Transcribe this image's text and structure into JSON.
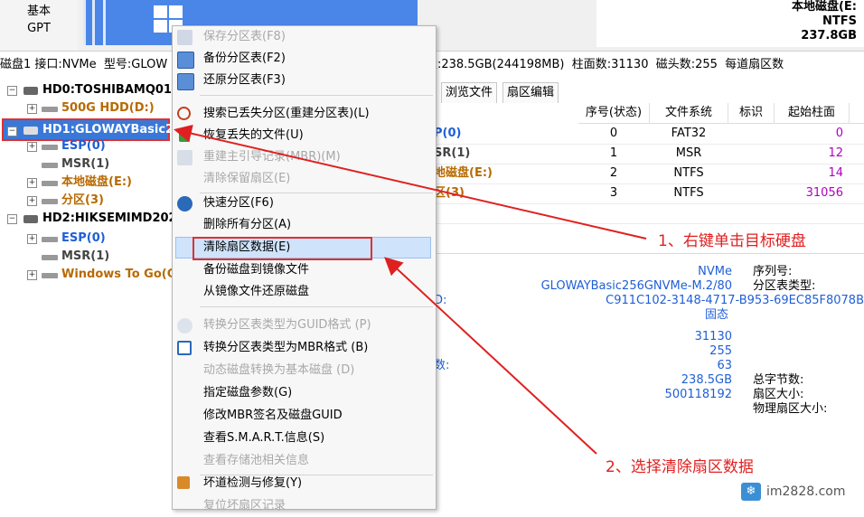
{
  "disk_strip": {
    "basic_label": "基本",
    "gpt_label": "GPT",
    "volume_name": "本地磁盘(E:",
    "volume_fs": "NTFS",
    "volume_size": "237.8GB"
  },
  "info_line": "磁盘1 接口:NVMe  型号:GLOW                                                    240057  容量:238.5GB(244198MB)  柱面数:31130  磁头数:255  每道扇区数",
  "tree": {
    "hd0": "HD0:TOSHIBAMQ01A",
    "hd0_vol": "500G HDD(D:)",
    "hd1": "HD1:GLOWAYBasic2",
    "hd1_vols": [
      "ESP(0)",
      "MSR(1)",
      "本地磁盘(E:)",
      "分区(3)"
    ],
    "hd2": "HD2:HIKSEMIMD202",
    "hd2_vols": [
      "ESP(0)",
      "MSR(1)",
      "Windows To Go(C"
    ]
  },
  "tabs": [
    "浏览文件",
    "扇区编辑"
  ],
  "grid": {
    "headers": [
      "序号(状态)",
      "文件系统",
      "标识",
      "起始柱面"
    ],
    "rows": [
      {
        "name": "P(0)",
        "idx": "0",
        "fs": "FAT32",
        "start": "0"
      },
      {
        "name": "SR(1)",
        "idx": "1",
        "fs": "MSR",
        "start": "12"
      },
      {
        "name": "地磁盘(E:)",
        "idx": "2",
        "fs": "NTFS",
        "start": "14"
      },
      {
        "name": "区(3)",
        "idx": "3",
        "fs": "NTFS",
        "start": "31056"
      }
    ]
  },
  "detail": {
    "interface": "NVMe",
    "model": "GLOWAYBasic256GNVMe-M.2/80",
    "guid": "C911C102-3148-4717-B953-69EC85F8078B",
    "media": "固态",
    "cylinders": "31130",
    "heads": "255",
    "sectors": "63",
    "capacity": "238.5GB",
    "total_sectors": "500118192",
    "label_serial": "序列号:",
    "label_ptype": "分区表类型:",
    "label_total_bytes": "总字节数:",
    "label_sector_size": "扇区大小:",
    "label_phys_sector": "物理扇区大小:",
    "frag_d": "D:",
    "frag_shu": "数:"
  },
  "menu": {
    "items": [
      {
        "label": "保存分区表(F8)",
        "enabled": false,
        "icon": "save-icon"
      },
      {
        "label": "备份分区表(F2)",
        "enabled": true,
        "icon": "backup-table-icon"
      },
      {
        "label": "还原分区表(F3)",
        "enabled": true,
        "icon": "restore-table-icon"
      },
      {
        "label": "搜索已丢失分区(重建分区表)(L)",
        "enabled": true,
        "icon": "search-icon"
      },
      {
        "label": "恢复丢失的文件(U)",
        "enabled": true,
        "icon": "recover-files-icon"
      },
      {
        "label": "重建主引导记录(MBR)(M)",
        "enabled": false,
        "icon": "rebuild-mbr-icon"
      },
      {
        "label": "清除保留扇区(E)",
        "enabled": false,
        "icon": ""
      },
      {
        "label": "快速分区(F6)",
        "enabled": true,
        "icon": "quick-partition-icon"
      },
      {
        "label": "删除所有分区(A)",
        "enabled": true,
        "icon": ""
      },
      {
        "label": "清除扇区数据(E)",
        "enabled": true,
        "icon": ""
      },
      {
        "label": "备份磁盘到镜像文件",
        "enabled": true,
        "icon": ""
      },
      {
        "label": "从镜像文件还原磁盘",
        "enabled": true,
        "icon": ""
      },
      {
        "label": "转换分区表类型为GUID格式 (P)",
        "enabled": false,
        "icon": "convert-guid-icon"
      },
      {
        "label": "转换分区表类型为MBR格式 (B)",
        "enabled": true,
        "icon": "convert-mbr-icon"
      },
      {
        "label": "动态磁盘转换为基本磁盘 (D)",
        "enabled": false,
        "icon": ""
      },
      {
        "label": "指定磁盘参数(G)",
        "enabled": true,
        "icon": ""
      },
      {
        "label": "修改MBR签名及磁盘GUID",
        "enabled": true,
        "icon": ""
      },
      {
        "label": "查看S.M.A.R.T.信息(S)",
        "enabled": true,
        "icon": ""
      },
      {
        "label": "查看存储池相关信息",
        "enabled": false,
        "icon": ""
      },
      {
        "label": "坏道检测与修复(Y)",
        "enabled": true,
        "icon": "bad-sector-tool-icon"
      },
      {
        "label": "复位坏扇区记录",
        "enabled": false,
        "icon": ""
      }
    ]
  },
  "annotations": {
    "step1": "1、右键单击目标硬盘",
    "step2": "2、选择清除扇区数据"
  },
  "watermark": "im2828.com",
  "colors": {
    "accent_blue": "#3a78d8",
    "annotation_red": "#e02020",
    "orange_volume": "#b86a00",
    "blue_volume": "#1f5fd6",
    "purple_value": "#b000c0"
  }
}
